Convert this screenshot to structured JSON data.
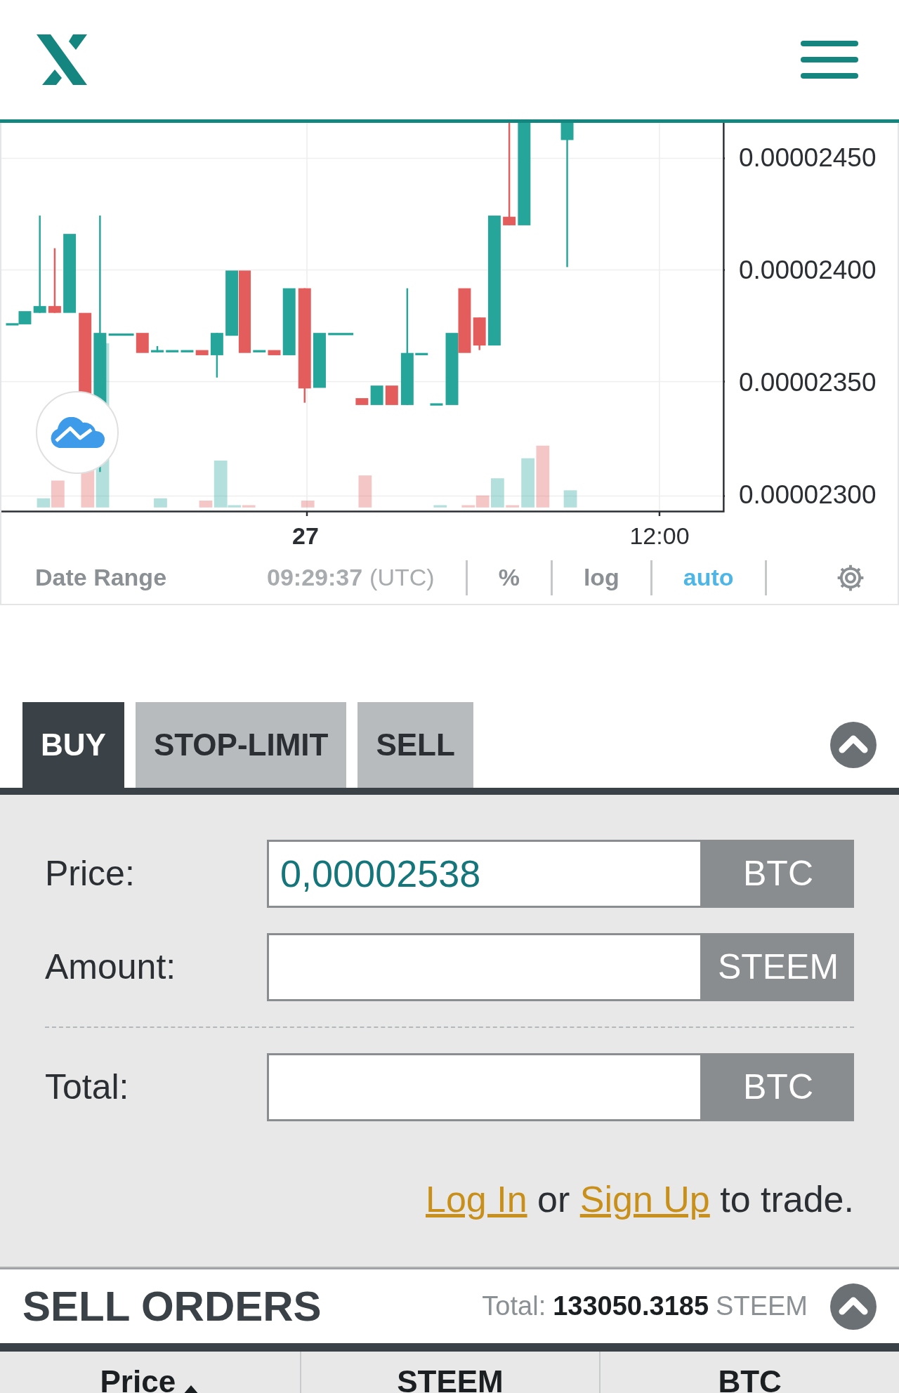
{
  "chart": {
    "y_axis_labels": [
      "0.00002450",
      "0.00002400",
      "0.00002350",
      "0.00002300"
    ],
    "x_axis_labels": [
      {
        "label": "27",
        "emphasized": true
      },
      {
        "label": "12:00",
        "emphasized": false
      }
    ]
  },
  "toolbar": {
    "date_range": "Date Range",
    "time": "09:29:37",
    "timezone": "(UTC)",
    "options": [
      {
        "label": "%",
        "selected": false
      },
      {
        "label": "log",
        "selected": false
      },
      {
        "label": "auto",
        "selected": true
      }
    ]
  },
  "order_form": {
    "tabs": [
      {
        "label": "BUY",
        "selected": true
      },
      {
        "label": "STOP-LIMIT",
        "selected": false
      },
      {
        "label": "SELL",
        "selected": false
      }
    ],
    "fields": [
      {
        "kind": "input",
        "label": "Price:",
        "value": "0,00002538",
        "unit": "BTC"
      },
      {
        "kind": "input",
        "label": "Amount:",
        "unit": "STEEM"
      },
      {
        "kind": "total",
        "label": "Total:",
        "unit": "BTC"
      }
    ],
    "auth": {
      "login": "Log In",
      "or": "or",
      "signup": "Sign Up",
      "tail": "to trade."
    }
  },
  "sell_orders": {
    "title": "SELL ORDERS",
    "total_label": "Total:",
    "total_value": "133050.3185",
    "total_unit": "STEEM",
    "columns": [
      {
        "label": "Price",
        "sorted": true
      },
      {
        "label": "STEEM"
      },
      {
        "label": "BTC"
      }
    ]
  }
}
